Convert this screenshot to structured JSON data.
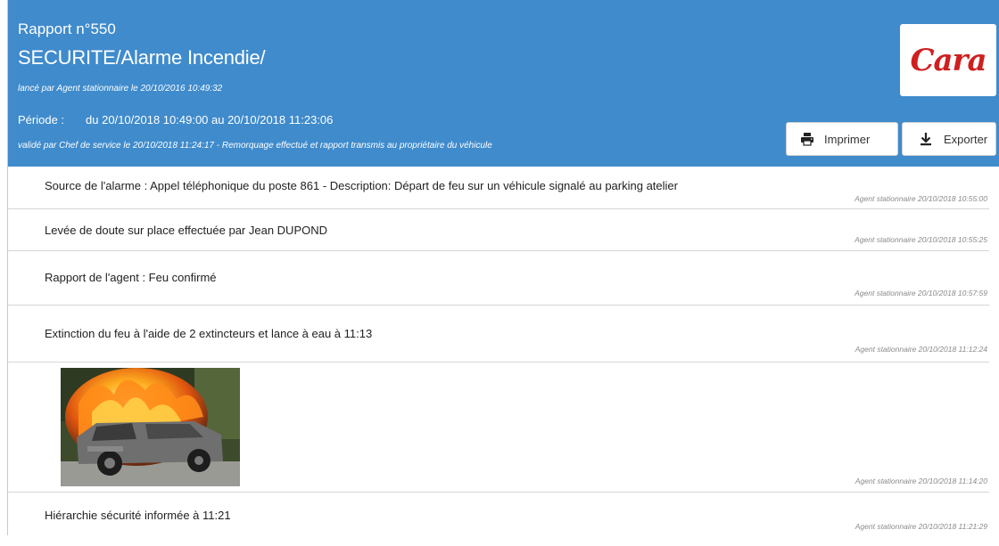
{
  "header": {
    "report_number": "Rapport n°550",
    "title": "SECURITE/Alarme Incendie/",
    "launched_by": "lancé par Agent stationnaire le 20/10/2016 10:49:32",
    "period_label": "Période :",
    "period_value": "du 20/10/2018 10:49:00 au 20/10/2018 11:23:06",
    "validated_by": "validé par Chef de service le 20/10/2018 11:24:17 - Remorquage effectué et rapport transmis au propriétaire du véhicule",
    "logo_text": "Cara",
    "background_color": "#3f8bcc"
  },
  "buttons": {
    "print_label": "Imprimer",
    "print_icon": "printer-icon",
    "export_label": "Exporter",
    "export_icon": "download-icon"
  },
  "entries": [
    {
      "text": "Source de l'alarme : Appel téléphonique du poste 861     - Description: Départ de feu sur un véhicule signalé au parking atelier",
      "meta": "Agent stationnaire 20/10/2018 10:55:00"
    },
    {
      "text": "Levée de doute sur place effectuée par Jean DUPOND",
      "meta": "Agent stationnaire 20/10/2018 10:55:25"
    },
    {
      "text": "Rapport de l'agent : Feu confirmé",
      "meta": "Agent stationnaire 20/10/2018 10:57:59"
    },
    {
      "text": "Extinction du feu à l'aide de 2 extincteurs et lance à eau à 11:13",
      "meta": "Agent stationnaire 20/10/2018 11:12:24"
    },
    {
      "text": "",
      "meta": "Agent stationnaire 20/10/2018 11:14:20",
      "image": "burning-car-photo"
    },
    {
      "text": "Hiérarchie sécurité informée à 11:21",
      "meta": "Agent stationnaire 20/10/2018 11:21:29"
    }
  ]
}
